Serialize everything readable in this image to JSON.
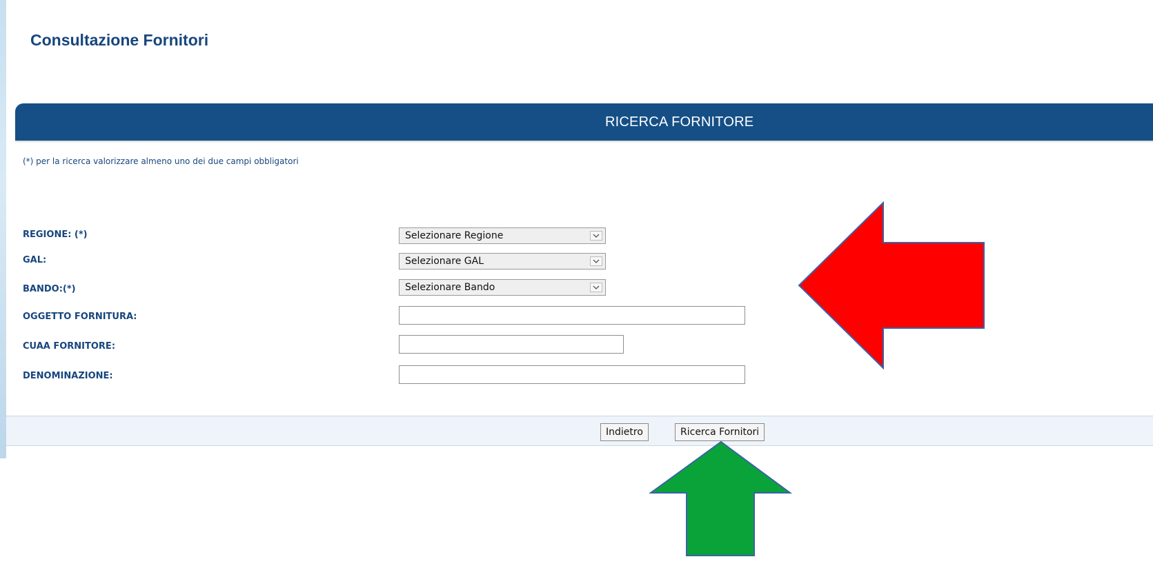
{
  "page": {
    "title": "Consultazione Fornitori"
  },
  "section": {
    "header": "RICERCA FORNITORE",
    "note": "(*) per la ricerca valorizzare almeno uno dei due campi obbligatori"
  },
  "form": {
    "regione": {
      "label": "REGIONE: (*)",
      "selected": "Selezionare Regione"
    },
    "gal": {
      "label": "GAL:",
      "selected": "Selezionare GAL"
    },
    "bando": {
      "label": "BANDO:(*)",
      "selected": "Selezionare Bando"
    },
    "oggetto_fornitura": {
      "label": "OGGETTO FORNITURA:",
      "value": ""
    },
    "cuaa_fornitore": {
      "label": "CUAA FORNITORE:",
      "value": ""
    },
    "denominazione": {
      "label": "DENOMINAZIONE:",
      "value": ""
    }
  },
  "actions": {
    "back_label": "Indietro",
    "search_label": "Ricerca Fornitori"
  },
  "annotations": {
    "left_arrow_color": "#ff0000",
    "up_arrow_color": "#0aa33a",
    "arrow_outline_color": "#3a62a7"
  },
  "icons": {
    "dropdown": "chevron-down-icon"
  },
  "colors": {
    "header_bar": "#154f86",
    "label_text": "#17467d",
    "footer_bar": "#eef4fa"
  }
}
